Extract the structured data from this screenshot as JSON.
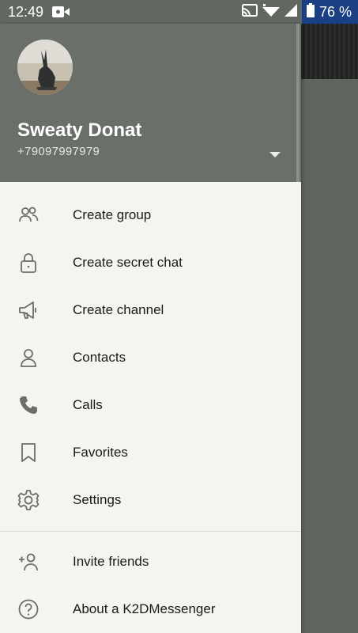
{
  "status_bar": {
    "time": "12:49",
    "battery_percent": "76 %"
  },
  "profile": {
    "name": "Sweaty Donat",
    "phone": "+79097997979"
  },
  "menu": {
    "items": [
      {
        "label": "Create group",
        "icon": "people-icon"
      },
      {
        "label": "Create secret chat",
        "icon": "lock-icon"
      },
      {
        "label": "Create channel",
        "icon": "megaphone-icon"
      },
      {
        "label": "Contacts",
        "icon": "person-icon"
      },
      {
        "label": "Calls",
        "icon": "phone-icon"
      },
      {
        "label": "Favorites",
        "icon": "bookmark-icon"
      },
      {
        "label": "Settings",
        "icon": "gear-icon"
      }
    ],
    "secondary_items": [
      {
        "label": "Invite friends",
        "icon": "add-person-icon"
      },
      {
        "label": "About a K2DMessenger",
        "icon": "help-icon"
      }
    ]
  },
  "colors": {
    "header_bg": "#6a7069",
    "drawer_bg": "#f4f4f0",
    "status_battery_bg": "#1b3f83"
  }
}
